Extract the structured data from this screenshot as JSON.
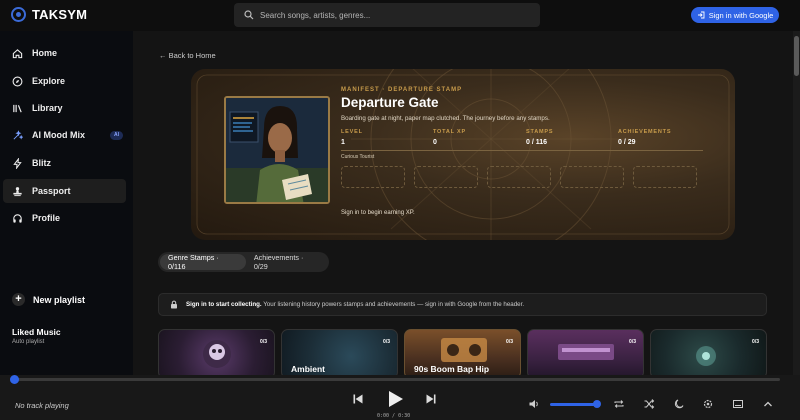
{
  "app": {
    "name": "TAKSYM"
  },
  "search": {
    "placeholder": "Search songs, artists, genres..."
  },
  "auth": {
    "signin_label": "Sign in with Google"
  },
  "sidebar": {
    "items": [
      {
        "label": "Home",
        "icon": "home-icon"
      },
      {
        "label": "Explore",
        "icon": "compass-icon"
      },
      {
        "label": "Library",
        "icon": "library-icon"
      },
      {
        "label": "AI Mood Mix",
        "icon": "sparkle-icon",
        "badge": "AI"
      },
      {
        "label": "Blitz",
        "icon": "bolt-icon"
      },
      {
        "label": "Passport",
        "icon": "stamp-icon",
        "active": true
      },
      {
        "label": "Profile",
        "icon": "headphones-icon"
      }
    ],
    "new_playlist": "New playlist",
    "liked": {
      "title": "Liked Music",
      "subtitle": "Auto playlist"
    }
  },
  "main": {
    "back_label": "← Back to Home",
    "banner": {
      "kicker": "MANIFEST · DEPARTURE STAMP",
      "title": "Departure Gate",
      "subtitle": "Boarding gate at night, paper map clutched. The journey before any stamps.",
      "stats": [
        {
          "label": "LEVEL",
          "value": "1"
        },
        {
          "label": "TOTAL XP",
          "value": "0"
        },
        {
          "label": "STAMPS",
          "value": "0 / 116"
        },
        {
          "label": "ACHIEVEMENTS",
          "value": "0 / 29"
        }
      ],
      "rank": "Curious Tourist",
      "note": "Sign in to begin earning XP."
    },
    "tabs": [
      {
        "label": "Genre Stamps · 0/116",
        "active": true
      },
      {
        "label": "Achievements · 0/29",
        "active": false
      }
    ],
    "notice": {
      "bold": "Sign in to start collecting.",
      "text": "Your listening history powers stamps and achievements — sign in with Google from the header."
    },
    "cards": [
      {
        "label": "",
        "count": "0/3"
      },
      {
        "label": "Ambient",
        "count": "0/3"
      },
      {
        "label": "90s Boom Bap Hip",
        "count": "0/3"
      },
      {
        "label": "",
        "count": "0/3"
      },
      {
        "label": "",
        "count": "0/3"
      }
    ]
  },
  "player": {
    "now_playing": "No track playing",
    "time": "0:00 / 0:30",
    "volume": 0.9,
    "progress": 0
  },
  "colors": {
    "accent": "#2f63e6",
    "gold": "#c79b4b"
  }
}
